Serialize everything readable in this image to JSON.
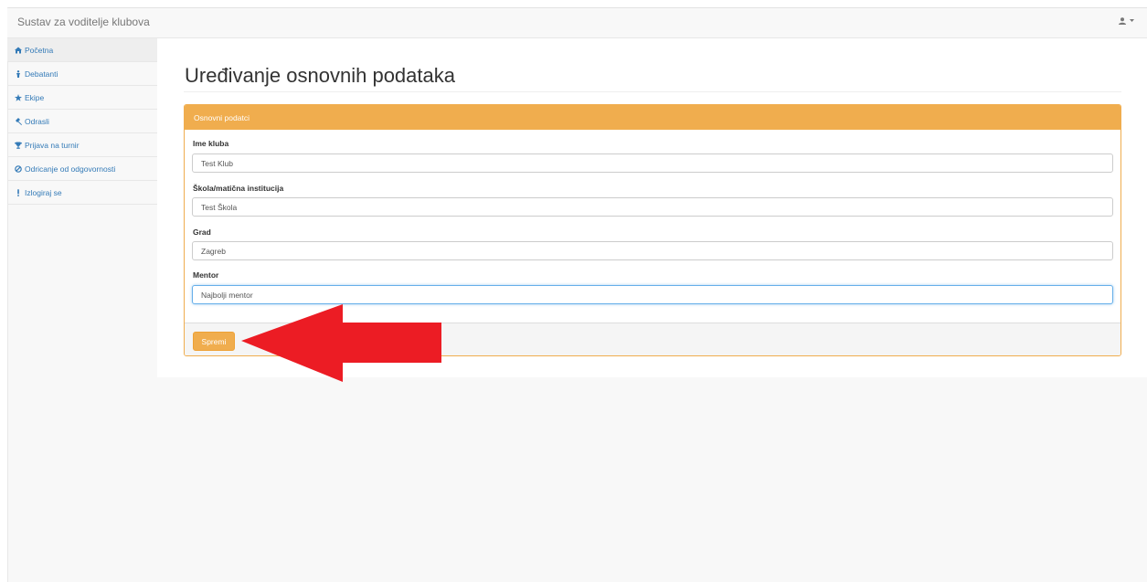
{
  "app": {
    "brand": "Sustav za voditelje klubova",
    "user_icon": "user-icon",
    "caret_icon": "caret-down-icon"
  },
  "sidebar": {
    "items": [
      {
        "label": "Početna",
        "icon": "home-icon",
        "active": true
      },
      {
        "label": "Debatanti",
        "icon": "person-icon",
        "active": false
      },
      {
        "label": "Ekipe",
        "icon": "star-icon",
        "active": false
      },
      {
        "label": "Odrasli",
        "icon": "gavel-icon",
        "active": false
      },
      {
        "label": "Prijava na turnir",
        "icon": "trophy-icon",
        "active": false
      },
      {
        "label": "Odricanje od odgovornosti",
        "icon": "ban-icon",
        "active": false
      },
      {
        "label": "Izlogiraj se",
        "icon": "exclamation-icon",
        "active": false
      }
    ]
  },
  "main": {
    "title": "Uređivanje osnovnih podataka",
    "panel": {
      "heading": "Osnovni podatci",
      "fields": [
        {
          "label": "Ime kluba",
          "value": "Test Klub"
        },
        {
          "label": "Škola/matična institucija",
          "value": "Test Škola"
        },
        {
          "label": "Grad",
          "value": "Zagreb"
        },
        {
          "label": "Mentor",
          "value": "Najbolji mentor"
        }
      ],
      "save_label": "Spremi"
    }
  },
  "colors": {
    "accent": "#f0ad4e",
    "link": "#337ab7",
    "arrow": "#ec1c24"
  }
}
